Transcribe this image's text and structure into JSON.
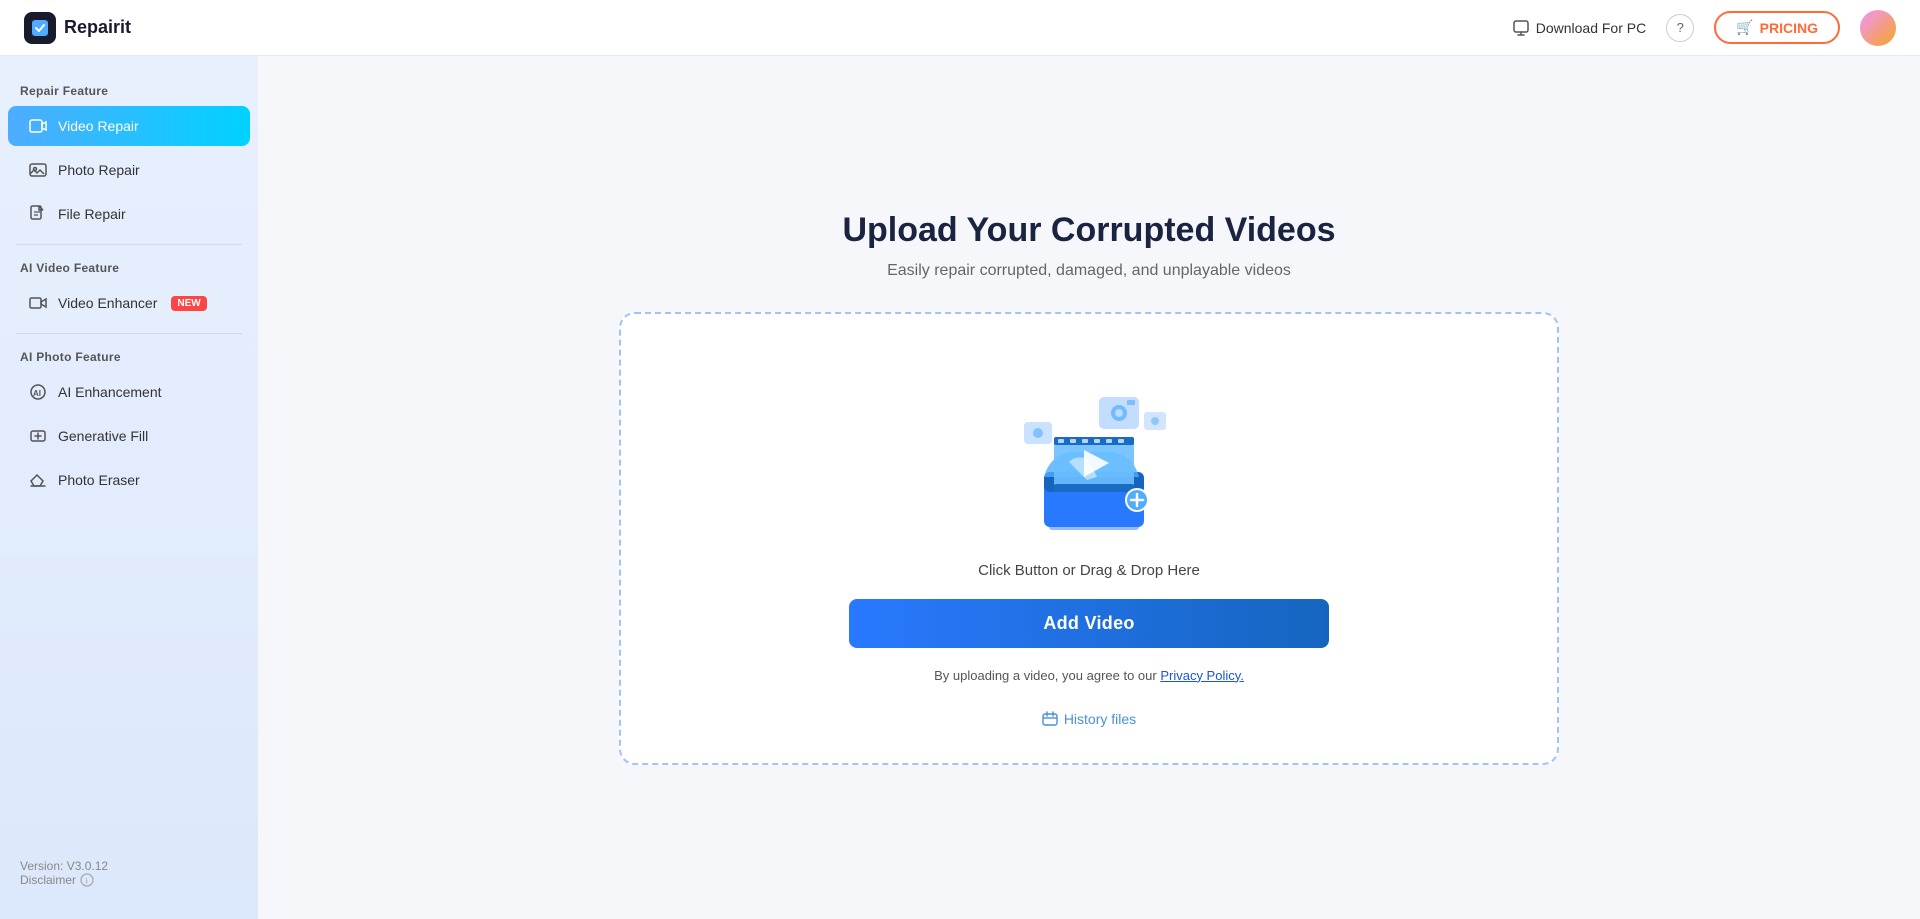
{
  "header": {
    "logo_icon": "🔧",
    "logo_text": "Repairit",
    "download_label": "Download For PC",
    "help_icon": "?",
    "pricing_label": "PRICING",
    "pricing_icon": "🛒"
  },
  "sidebar": {
    "repair_feature_label": "Repair Feature",
    "video_repair_label": "Video Repair",
    "photo_repair_label": "Photo Repair",
    "file_repair_label": "File Repair",
    "ai_video_feature_label": "AI Video Feature",
    "video_enhancer_label": "Video Enhancer",
    "video_enhancer_badge": "NEW",
    "ai_photo_feature_label": "AI Photo Feature",
    "ai_enhancement_label": "AI Enhancement",
    "generative_fill_label": "Generative Fill",
    "photo_eraser_label": "Photo Eraser",
    "version_label": "Version: V3.0.12",
    "disclaimer_label": "Disclaimer"
  },
  "main": {
    "title": "Upload Your Corrupted Videos",
    "subtitle": "Easily repair corrupted, damaged, and unplayable videos",
    "drop_hint": "Click Button or Drag & Drop Here",
    "add_video_label": "Add Video",
    "privacy_text_before": "By uploading a video, you agree to our ",
    "privacy_policy_label": "Privacy Policy.",
    "history_files_label": "History files"
  }
}
